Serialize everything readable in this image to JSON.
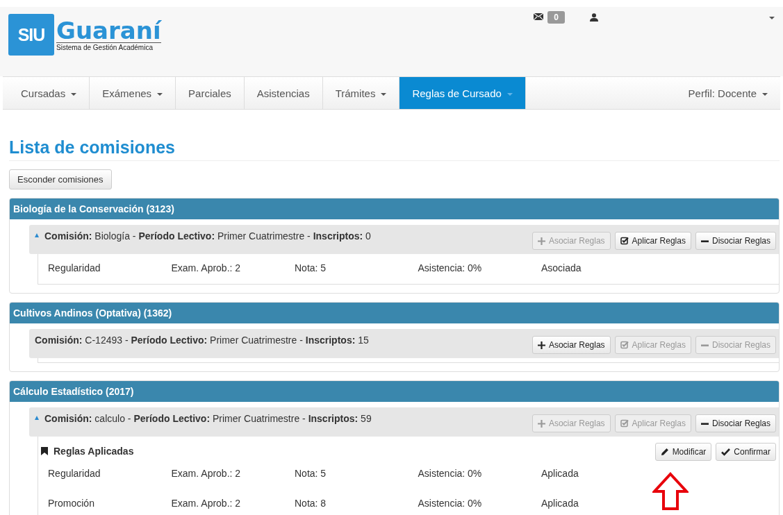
{
  "header": {
    "logo": {
      "short": "SIU",
      "name": "Guaraní",
      "tagline": "Sistema de Gestión Académica"
    },
    "message_count": "0"
  },
  "nav": {
    "items": [
      {
        "label": "Cursadas",
        "dropdown": true,
        "selected": false
      },
      {
        "label": "Exámenes",
        "dropdown": true,
        "selected": false
      },
      {
        "label": "Parciales",
        "dropdown": false,
        "selected": false
      },
      {
        "label": "Asistencias",
        "dropdown": false,
        "selected": false
      },
      {
        "label": "Trámites",
        "dropdown": true,
        "selected": false
      },
      {
        "label": "Reglas de Cursado",
        "dropdown": true,
        "selected": true
      }
    ],
    "profile": "Perfil: Docente"
  },
  "page_title": "Lista de comisiones",
  "toggle_button": "Esconder comisiones",
  "subjects": [
    {
      "title": "Biología de la Conservación (3123)",
      "commissions": [
        {
          "expand_marker": true,
          "text": "**Comisión:** Biología - **Período Lectivo:** Primer Cuatrimestre - **Inscriptos:** 0",
          "buttons": [
            {
              "label": "Asociar Reglas",
              "kind": "plus",
              "disabled": true
            },
            {
              "label": "Aplicar Reglas",
              "kind": "check-square",
              "disabled": false
            },
            {
              "label": "Disociar Reglas",
              "kind": "minus",
              "disabled": false
            }
          ],
          "rules": [
            [
              "Regularidad",
              "Exam. Aprob.: 2",
              "Nota: 5",
              "Asistencia: 0%",
              "Asociada"
            ]
          ]
        }
      ]
    },
    {
      "title": "Cultivos Andinos (Optativa) (1362)",
      "commissions": [
        {
          "expand_marker": false,
          "text": "**Comisión:** C-12493 - **Período Lectivo:** Primer Cuatrimestre - **Inscriptos:** 15",
          "buttons": [
            {
              "label": "Asociar Reglas",
              "kind": "plus",
              "disabled": false
            },
            {
              "label": "Aplicar Reglas",
              "kind": "check-square",
              "disabled": true
            },
            {
              "label": "Disociar Reglas",
              "kind": "minus",
              "disabled": true
            }
          ]
        }
      ]
    },
    {
      "title": "Cálculo Estadístico (2017)",
      "commissions": [
        {
          "expand_marker": true,
          "text": "**Comisión:** calculo - **Período Lectivo:** Primer Cuatrimestre - **Inscriptos:** 59",
          "buttons": [
            {
              "label": "Asociar Reglas",
              "kind": "plus",
              "disabled": true
            },
            {
              "label": "Aplicar Reglas",
              "kind": "check-square",
              "disabled": true
            },
            {
              "label": "Disociar Reglas",
              "kind": "minus",
              "disabled": false
            }
          ],
          "rules_heading": "Reglas Aplicadas",
          "rule_actions": [
            {
              "label": "Modificar",
              "kind": "pencil",
              "disabled": false
            },
            {
              "label": "Confirmar",
              "kind": "check",
              "disabled": false
            }
          ],
          "rules": [
            [
              "Regularidad",
              "Exam. Aprob.: 2",
              "Nota: 5",
              "Asistencia: 0%",
              "Aplicada"
            ],
            [
              "Promoción",
              "Exam. Aprob.: 2",
              "Nota: 8",
              "Asistencia: 0%",
              "Aplicada"
            ]
          ]
        }
      ]
    }
  ]
}
